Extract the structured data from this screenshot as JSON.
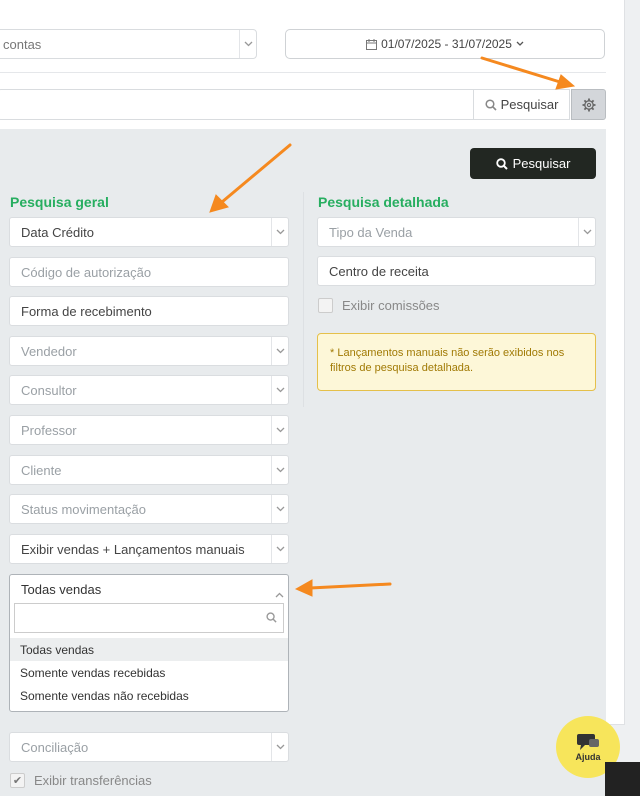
{
  "toolbar": {
    "account_select": "contas",
    "date_range": "01/07/2025 - 31/07/2025",
    "search_button": "Pesquisar"
  },
  "panel": {
    "search_button": "Pesquisar",
    "general": {
      "title": "Pesquisa geral",
      "fields": [
        {
          "label": "Data Crédito",
          "type": "select"
        },
        {
          "label": "Código de autorização",
          "type": "input"
        },
        {
          "label": "Forma de recebimento",
          "type": "input"
        },
        {
          "label": "Vendedor",
          "type": "select"
        },
        {
          "label": "Consultor",
          "type": "select"
        },
        {
          "label": "Professor",
          "type": "select"
        },
        {
          "label": "Cliente",
          "type": "select"
        },
        {
          "label": "Status movimentação",
          "type": "select"
        },
        {
          "label": "Exibir vendas + Lançamentos manuais",
          "type": "select"
        }
      ],
      "open_dropdown": {
        "selected": "Todas vendas",
        "options": [
          "Todas vendas",
          "Somente vendas recebidas",
          "Somente vendas não recebidas"
        ]
      },
      "conciliacao": "Conciliação",
      "show_transfers": "Exibir transferências"
    },
    "detailed": {
      "title": "Pesquisa detalhada",
      "sale_type": "Tipo da Venda",
      "revenue_center": "Centro de receita",
      "show_commissions": "Exibir comissões",
      "note": "* Lançamentos manuais não serão exibidos nos filtros de pesquisa detalhada."
    }
  },
  "help": {
    "label": "Ajuda"
  },
  "colors": {
    "accent_green": "#27ae60",
    "dark_button": "#222722",
    "note_bg": "#fdf7d8",
    "arrow": "#f5891f",
    "help_bg": "#f7e55b"
  }
}
